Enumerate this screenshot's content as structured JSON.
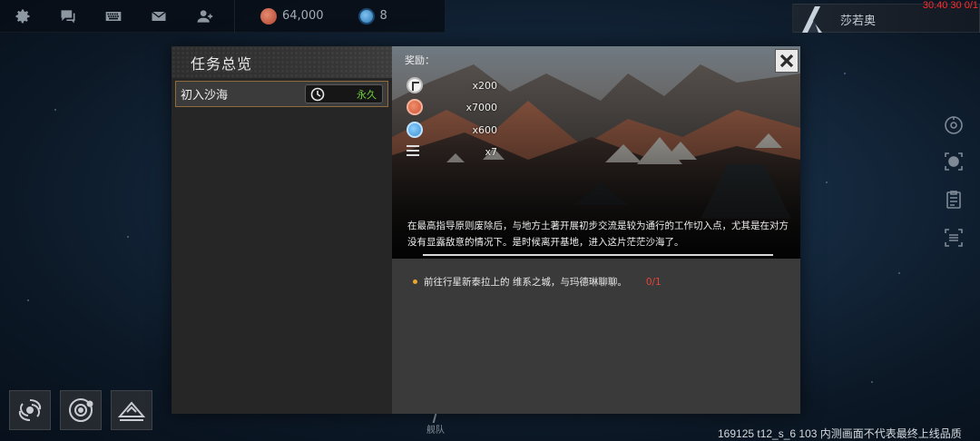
{
  "topbar": {
    "icons": [
      "gear-icon",
      "chat-icon",
      "keyboard-icon",
      "mail-icon",
      "friends-icon"
    ],
    "resources": [
      {
        "name": "coin",
        "value": "64,000",
        "color": "#c9553d"
      },
      {
        "name": "gem",
        "value": "8",
        "color": "#3f8cc9"
      }
    ]
  },
  "player": {
    "name": "莎若奥",
    "debug_top": "30.40 30 0/1"
  },
  "dialog": {
    "title": "任务总览",
    "quest": {
      "name": "初入沙海",
      "duration": "永久"
    },
    "rewards_label": "奖励：",
    "rewards": [
      {
        "icon": "badge-icon",
        "qty": "x200"
      },
      {
        "icon": "coin-icon",
        "qty": "x7000"
      },
      {
        "icon": "gem-icon",
        "qty": "x600"
      },
      {
        "icon": "list-icon",
        "qty": "x7"
      }
    ],
    "description": "在最高指导原则废除后，与地方土著开展初步交流是较为通行的工作切入点，尤其是在对方没有显露敌意的情况下。是时候离开基地，进入这片茫茫沙海了。",
    "objective": {
      "text": "前往行星新泰拉上的 维系之城，与玛德琳聊聊。",
      "progress": "0/1"
    }
  },
  "bottom": {
    "fleet_label": "舰队",
    "debug_bottom": "169125 t12_s_6 103  内测画面不代表最终上线品质"
  },
  "colors": {
    "accent_gold": "#8e6c3e",
    "duration_green": "#6fcf3a",
    "progress_red": "#e0463a",
    "debug_red": "#ff2b2b"
  }
}
